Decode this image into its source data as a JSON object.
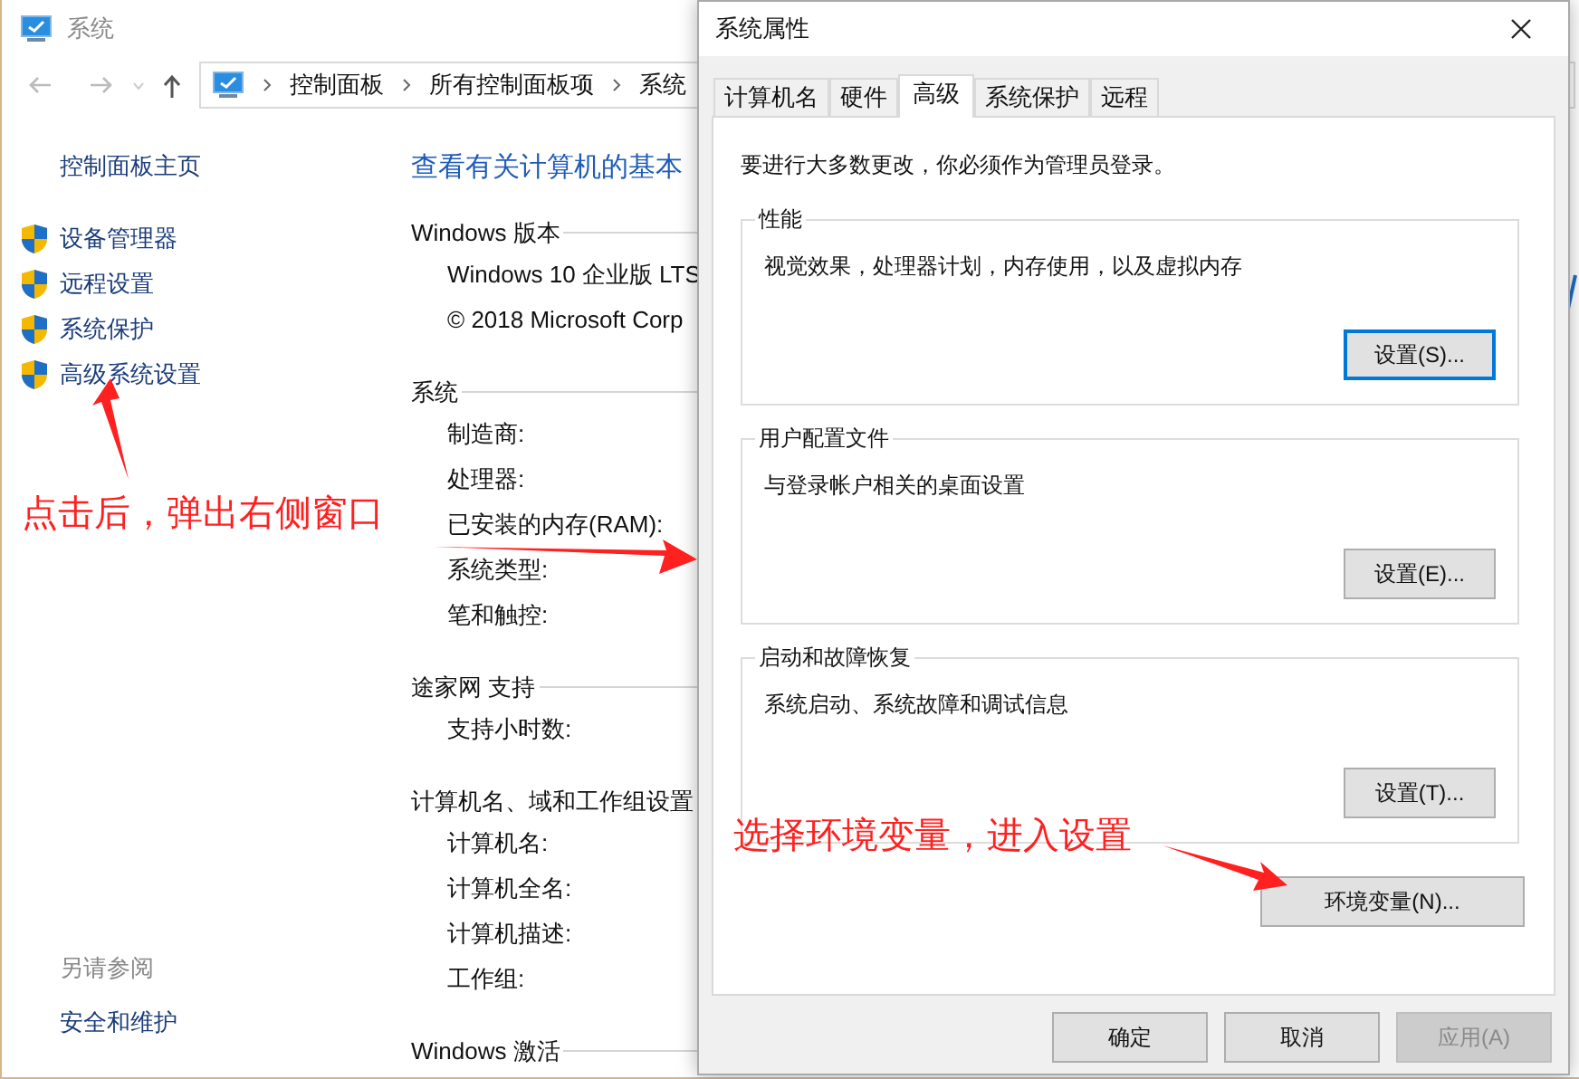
{
  "window": {
    "title": "系统",
    "breadcrumb": [
      "控制面板",
      "所有控制面板项",
      "系统"
    ],
    "sidebar": {
      "home": "控制面板主页",
      "items": [
        "设备管理器",
        "远程设置",
        "系统保护",
        "高级系统设置"
      ],
      "see_also_title": "另请参阅",
      "see_also_items": [
        "安全和维护"
      ]
    },
    "main": {
      "heading": "查看有关计算机的基本",
      "sections": [
        {
          "title": "Windows 版本",
          "rows": [
            "Windows 10 企业版 LTS",
            "© 2018 Microsoft Corp"
          ]
        },
        {
          "title": "系统",
          "rows": [
            "制造商:",
            "处理器:",
            "已安装的内存(RAM):",
            "系统类型:",
            "笔和触控:"
          ]
        },
        {
          "title": "途家网 支持",
          "rows": [
            "支持小时数:"
          ]
        },
        {
          "title": "计算机名、域和工作组设置",
          "rows": [
            "计算机名:",
            "计算机全名:",
            "计算机描述:",
            "工作组:"
          ]
        },
        {
          "title": "Windows 激活"
        }
      ]
    }
  },
  "dialog": {
    "title": "系统属性",
    "tabs": [
      {
        "label": "计算机名",
        "selected": false
      },
      {
        "label": "硬件",
        "selected": false
      },
      {
        "label": "高级",
        "selected": true
      },
      {
        "label": "系统保护",
        "selected": false
      },
      {
        "label": "远程",
        "selected": false
      }
    ],
    "notice": "要进行大多数更改，你必须作为管理员登录。",
    "groups": [
      {
        "title": "性能",
        "description": "视觉效果，处理器计划，内存使用，以及虚拟内存",
        "button": "设置(S)...",
        "focused": true
      },
      {
        "title": "用户配置文件",
        "description": "与登录帐户相关的桌面设置",
        "button": "设置(E)...",
        "focused": false
      },
      {
        "title": "启动和故障恢复",
        "description": "系统启动、系统故障和调试信息",
        "button": "设置(T)...",
        "focused": false
      }
    ],
    "env_button": "环境变量(N)...",
    "buttons": [
      {
        "label": "确定",
        "disabled": false
      },
      {
        "label": "取消",
        "disabled": false
      },
      {
        "label": "应用(A)",
        "disabled": true
      }
    ]
  },
  "annotations": [
    {
      "text": "点击后，弹出右侧窗口"
    },
    {
      "text": "选择环境变量，进入设置"
    }
  ]
}
